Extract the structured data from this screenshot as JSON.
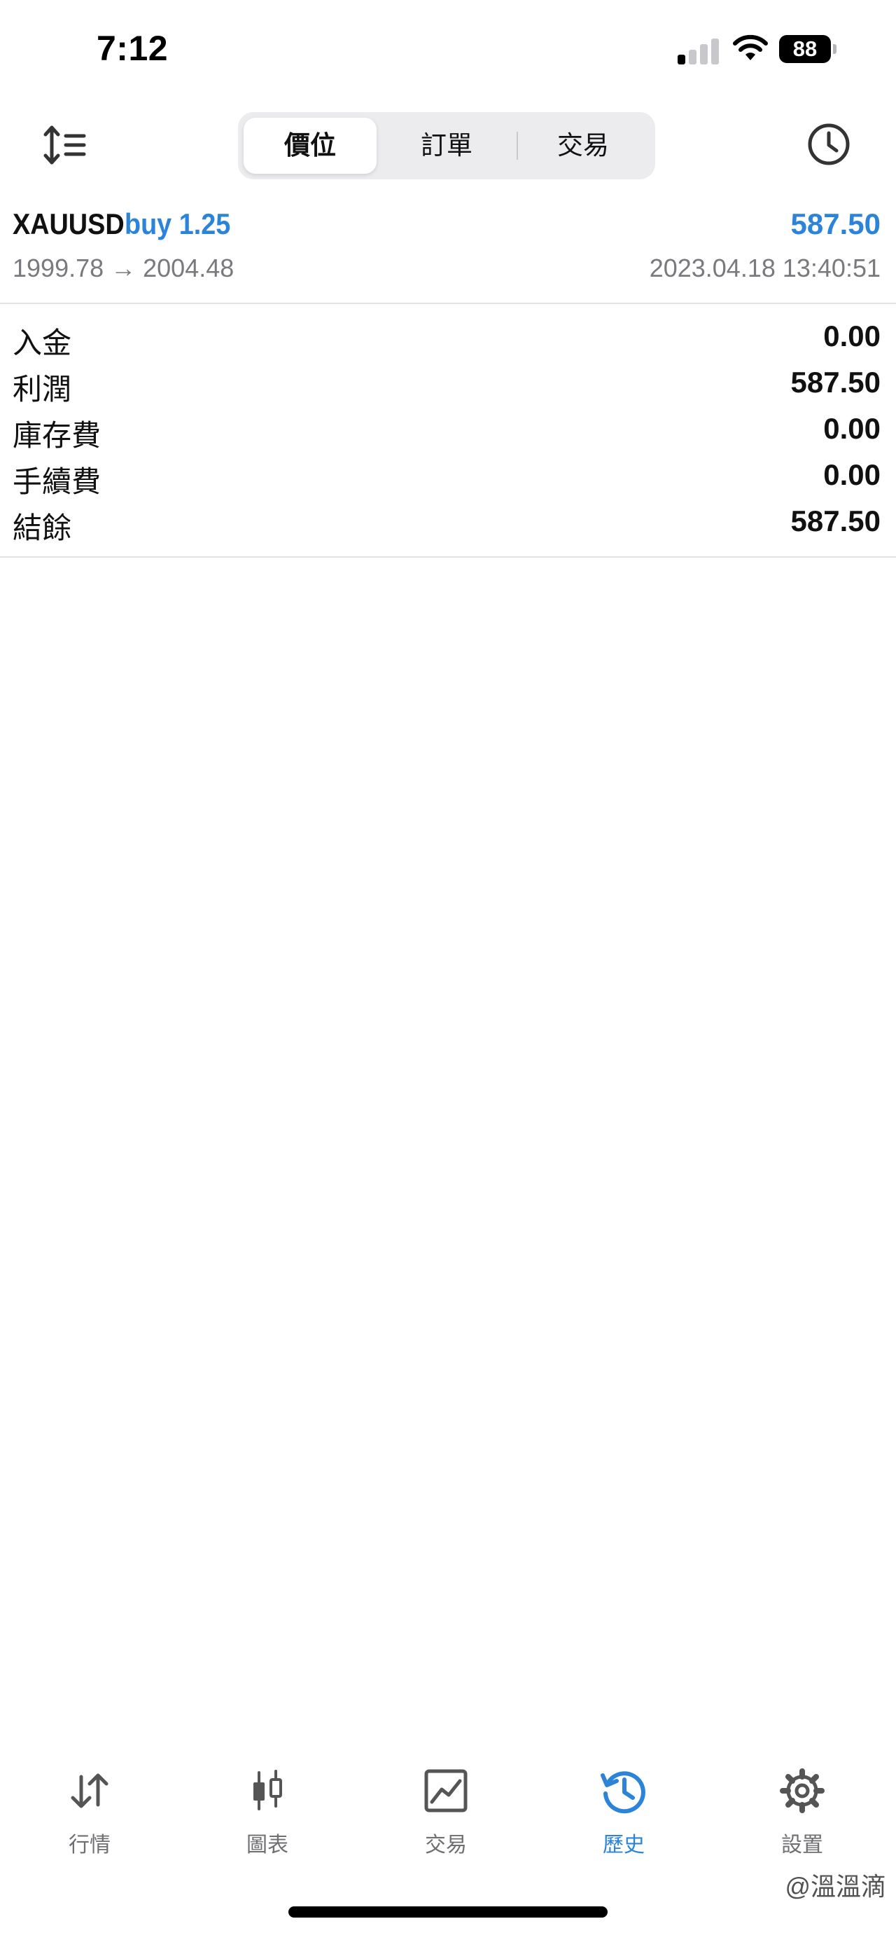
{
  "status_bar": {
    "time": "7:12",
    "battery": "88"
  },
  "toolbar": {
    "segments": [
      "價位",
      "訂單",
      "交易"
    ],
    "selected_segment": "價位"
  },
  "trade": {
    "symbol": "XAUUSD",
    "direction": "buy 1.25",
    "profit": "587.50",
    "prices": "1999.78 → 2004.48",
    "time": "2023.04.18 13:40:51"
  },
  "summary": [
    {
      "label": "入金",
      "value": "0.00"
    },
    {
      "label": "利潤",
      "value": "587.50"
    },
    {
      "label": "庫存費",
      "value": "0.00"
    },
    {
      "label": "手續費",
      "value": "0.00"
    },
    {
      "label": "結餘",
      "value": "587.50"
    }
  ],
  "tabbar": {
    "items": [
      {
        "label": "行情",
        "icon": "quotes-arrows-icon"
      },
      {
        "label": "圖表",
        "icon": "candlestick-chart-icon"
      },
      {
        "label": "交易",
        "icon": "trade-chart-icon"
      },
      {
        "label": "歷史",
        "icon": "history-icon"
      },
      {
        "label": "設置",
        "icon": "gear-icon"
      }
    ],
    "active": "歷史"
  },
  "watermark": "@溫溫滴",
  "colors": {
    "accent": "#2c84d8",
    "muted": "#7a7a7e",
    "divider": "#e3e3e6"
  }
}
